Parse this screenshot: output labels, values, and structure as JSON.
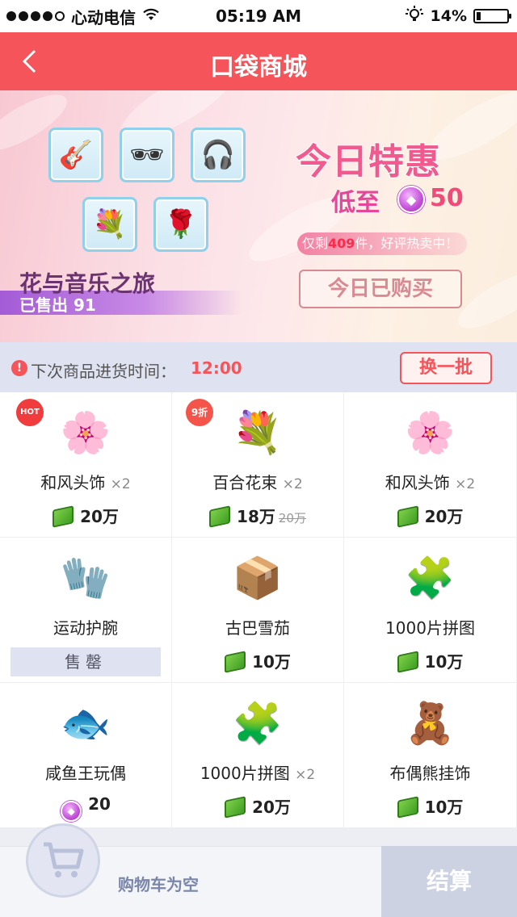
{
  "status": {
    "carrier": "心动电信",
    "time": "05:19 AM",
    "battery": "14%",
    "battery_level": 0.14
  },
  "nav": {
    "back_icon": "chevron-left-icon",
    "title": "口袋商城"
  },
  "banner": {
    "title": "花与音乐之旅",
    "sold": "已售出 91",
    "deal_title": "今日特惠",
    "deal_low": "低至",
    "deal_price": "50",
    "stock_prefix": "仅剩",
    "stock_num": "409",
    "stock_suffix": "件，好评热卖中！",
    "bought": "今日已购买",
    "items": [
      {
        "icon": "guitar-icon",
        "glyph": "🎸"
      },
      {
        "icon": "sunglasses-icon",
        "glyph": "🕶"
      },
      {
        "icon": "headphones-icon",
        "glyph": "🎧"
      },
      {
        "icon": "bouquet-icon",
        "glyph": "💐"
      },
      {
        "icon": "rose-icon",
        "glyph": "🌹"
      }
    ]
  },
  "restock": {
    "label": "下次商品进货时间：",
    "time": "12:00",
    "refresh": "换一批"
  },
  "products": [
    {
      "name": "和风头饰",
      "qty": "×2",
      "price": "20万",
      "currency": "cash",
      "badge": "HOT",
      "glyph": "🌸"
    },
    {
      "name": "百合花束",
      "qty": "×2",
      "price": "18万",
      "old_price": "20万",
      "currency": "cash",
      "badge": "9折",
      "glyph": "💐"
    },
    {
      "name": "和风头饰",
      "qty": "×2",
      "price": "20万",
      "currency": "cash",
      "glyph": "🌸"
    },
    {
      "name": "运动护腕",
      "qty": "",
      "soldout": "售罄",
      "glyph": "🧤"
    },
    {
      "name": "古巴雪茄",
      "qty": "",
      "price": "10万",
      "currency": "cash",
      "glyph": "📦"
    },
    {
      "name": "1000片拼图",
      "qty": "",
      "price": "10万",
      "currency": "cash",
      "glyph": "🧩"
    },
    {
      "name": "咸鱼王玩偶",
      "qty": "",
      "price": "20",
      "currency": "gem",
      "glyph": "🐟"
    },
    {
      "name": "1000片拼图",
      "qty": "×2",
      "price": "20万",
      "currency": "cash",
      "glyph": "🧩"
    },
    {
      "name": "布偶熊挂饰",
      "qty": "",
      "price": "10万",
      "currency": "cash",
      "glyph": "🧸"
    }
  ],
  "cart": {
    "icon": "shopping-cart-icon",
    "empty": "购物车为空",
    "checkout": "结算"
  },
  "colors": {
    "accent": "#f5545a",
    "gem": "#c450d8",
    "cash": "#4fb22c"
  }
}
